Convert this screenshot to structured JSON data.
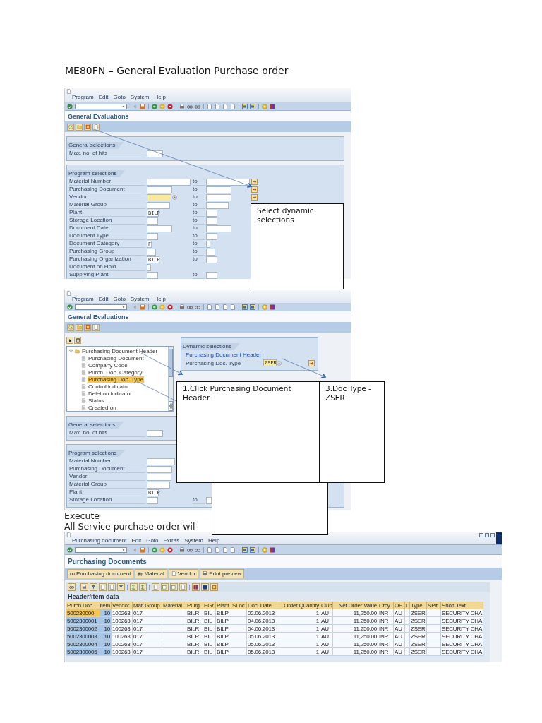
{
  "heading": "ME80FN – General Evaluation Purchase order",
  "selection_screen": {
    "menu": [
      "Program",
      "Edit",
      "Goto",
      "System",
      "Help"
    ],
    "title": "General Evaluations",
    "general_selections": {
      "title": "General selections",
      "rows": [
        {
          "label": "Max. no. of hits",
          "focused": false
        }
      ]
    },
    "program_selections": {
      "title": "Program selections",
      "rows": [
        {
          "label": "Material Number",
          "to": "to",
          "focused": false,
          "multi": true
        },
        {
          "label": "Purchasing Document",
          "to": "to",
          "focused": false,
          "multi": true
        },
        {
          "label": "Vendor",
          "to": "to",
          "focused": true,
          "multi": true
        },
        {
          "label": "Material Group",
          "to": "to",
          "focused": false
        },
        {
          "label": "Plant",
          "value": "BILP",
          "to": "to",
          "focused": false
        },
        {
          "label": "Storage Location",
          "to": "to",
          "focused": false
        },
        {
          "label": "Document Date",
          "to": "to",
          "focused": false
        },
        {
          "label": "Document Type",
          "to": "to",
          "focused": false
        },
        {
          "label": "Document Category",
          "value": "F",
          "to": "to",
          "focused": false
        },
        {
          "label": "Purchasing Group",
          "to": "to",
          "focused": false
        },
        {
          "label": "Purchasing Organization",
          "value": "BILR",
          "to": "to",
          "focused": false
        },
        {
          "label": "Document on Hold",
          "focused": false
        },
        {
          "label": "Supplying Plant",
          "to": "to",
          "focused": false
        }
      ]
    }
  },
  "dynamic_screen": {
    "menu": [
      "Program",
      "Edit",
      "Goto",
      "System",
      "Help"
    ],
    "title": "General Evaluations",
    "tree": {
      "label": "Purchasing Document Header",
      "expanded": true,
      "selected": false,
      "children": [
        {
          "label": "Purchasing Document",
          "selected": false
        },
        {
          "label": "Company Code",
          "selected": false
        },
        {
          "label": "Purch. Doc. Category",
          "selected": false
        },
        {
          "label": "Purchasing Doc. Type",
          "selected": true
        },
        {
          "label": "Control indicator",
          "selected": false
        },
        {
          "label": "Deletion indicator",
          "selected": false
        },
        {
          "label": "Status",
          "selected": false
        },
        {
          "label": "Created on",
          "selected": false
        }
      ]
    },
    "dynamic_selections": {
      "title": "Dynamic selections",
      "group": "Purchasing Document Header",
      "rows": [
        {
          "label": "Purchasing Doc. Type",
          "value": "ZSER",
          "focused": true,
          "multi": true
        }
      ]
    },
    "general_selections": {
      "title": "General selections",
      "rows": [
        {
          "label": "Max. no. of hits",
          "focused": false
        }
      ]
    },
    "program_selections": {
      "title": "Program selections",
      "rows": [
        {
          "label": "Material Number",
          "focused": false
        },
        {
          "label": "Purchasing Document",
          "focused": false
        },
        {
          "label": "Vendor",
          "focused": false
        },
        {
          "label": "Material Group",
          "focused": false
        },
        {
          "label": "Plant",
          "value": "BILP",
          "focused": false
        },
        {
          "label": "Storage Location",
          "to": "to",
          "focused": false
        }
      ]
    }
  },
  "execute_note": "Execute",
  "result_note": "All Service purchase order wil",
  "callouts": [
    {
      "kind": "text",
      "text": "Select dynamic selections"
    },
    {
      "kind": "blank"
    },
    {
      "kind": "text",
      "text": "1.Click Purchasing Document Header"
    },
    {
      "kind": "text",
      "text": "3.Doc Type - ZSER"
    }
  ],
  "result_screen": {
    "menu": [
      "Purchasing document",
      "Edit",
      "Goto",
      "Extras",
      "System",
      "Help"
    ],
    "title": "Purchasing Documents",
    "buttons": [
      "Purchasing document",
      "Material",
      "Vendor",
      "Print preview"
    ],
    "table": {
      "title": "Header/item data",
      "columns": [
        "Purch.Doc.",
        "Item",
        "Vendor",
        "Matl Group",
        "Material",
        "POrg",
        "PGr",
        "Plant",
        "SLoc",
        "Doc. Date",
        "Order Quantity",
        "OUn",
        "Net Order Value",
        "Crcy",
        "OP.",
        "I",
        "Type",
        "SPlt",
        "Short Text"
      ],
      "rows": [
        {
          "selected": true,
          "cells": [
            "500230000",
            "10",
            "100263",
            "017",
            "",
            "BILR",
            "BIL",
            "BILP",
            "",
            "02.06.2013",
            "1",
            "AU",
            "11,250.00",
            "INR",
            "AU",
            "",
            "ZSER",
            "",
            "SECURITY CHA"
          ]
        },
        {
          "selected": false,
          "cells": [
            "5002300001",
            "10",
            "100263",
            "017",
            "",
            "BILR",
            "BIL",
            "BILP",
            "",
            "04.06.2013",
            "1",
            "AU",
            "11,250.00",
            "INR",
            "AU",
            "",
            "ZSER",
            "",
            "SECURITY CHA"
          ]
        },
        {
          "selected": false,
          "cells": [
            "5002300002",
            "10",
            "100263",
            "017",
            "",
            "BILR",
            "BIL",
            "BILP",
            "",
            "04.06.2013",
            "1",
            "AU",
            "11,250.00",
            "INR",
            "AU",
            "",
            "ZSER",
            "",
            "SECURITY CHA"
          ]
        },
        {
          "selected": false,
          "cells": [
            "5002300003",
            "10",
            "100263",
            "017",
            "",
            "BILR",
            "BIL",
            "BILP",
            "",
            "05.06.2013",
            "1",
            "AU",
            "11,250.00",
            "INR",
            "AU",
            "",
            "ZSER",
            "",
            "SECURITY CHA"
          ]
        },
        {
          "selected": false,
          "cells": [
            "5002300004",
            "10",
            "100263",
            "017",
            "",
            "BILR",
            "BIL",
            "BILP",
            "",
            "05.06.2013",
            "1",
            "AU",
            "11,250.00",
            "INR",
            "AU",
            "",
            "ZSER",
            "",
            "SECURITY CHA"
          ]
        },
        {
          "selected": false,
          "cells": [
            "5002300005",
            "10",
            "100263",
            "017",
            "",
            "BILR",
            "BIL",
            "BILP",
            "",
            "05.06.2013",
            "1",
            "AU",
            "11,250.00",
            "INR",
            "AU",
            "",
            "ZSER",
            "",
            "SECURITY CHA"
          ]
        }
      ]
    }
  }
}
